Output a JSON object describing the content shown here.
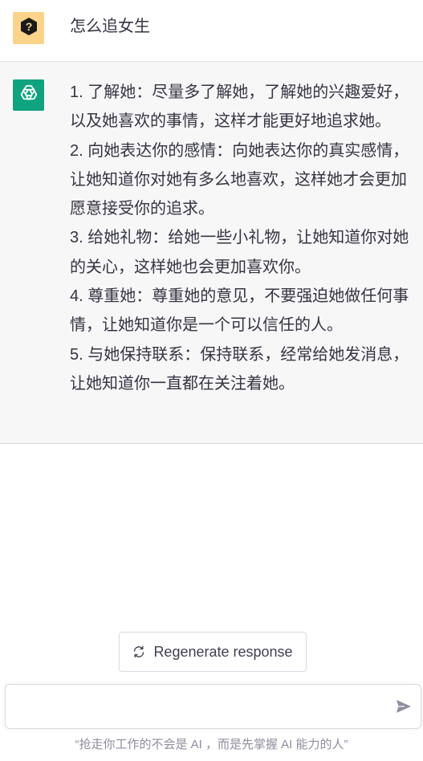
{
  "conversation": {
    "user_message": "怎么追女生",
    "assistant_paragraphs": [
      "1. 了解她：尽量多了解她，了解她的兴趣爱好，以及她喜欢的事情，这样才能更好地追求她。",
      "2. 向她表达你的感情：向她表达你的真实感情，让她知道你对她有多么地喜欢，这样她才会更加愿意接受你的追求。",
      "3. 给她礼物：给她一些小礼物，让她知道你对她的关心，这样她也会更加喜欢你。",
      "4. 尊重她：尊重她的意见，不要强迫她做任何事情，让她知道你是一个可以信任的人。",
      "5. 与她保持联系：保持联系，经常给她发消息，让她知道你一直都在关注着她。"
    ]
  },
  "controls": {
    "regenerate_label": "Regenerate response",
    "input_value": "",
    "input_placeholder": ""
  },
  "footer": {
    "note": "“抢走你工作的不会是 AI ，而是先掌握 AI 能力的人”"
  },
  "icons": {
    "user_avatar": "question-mark-icon",
    "assistant_avatar": "openai-logo-icon",
    "regenerate": "refresh-icon",
    "send": "paper-plane-icon"
  },
  "colors": {
    "user_avatar_bg": "#fcd38a",
    "assistant_avatar_bg": "#10a37f",
    "assistant_row_bg": "#f7f7f8"
  }
}
